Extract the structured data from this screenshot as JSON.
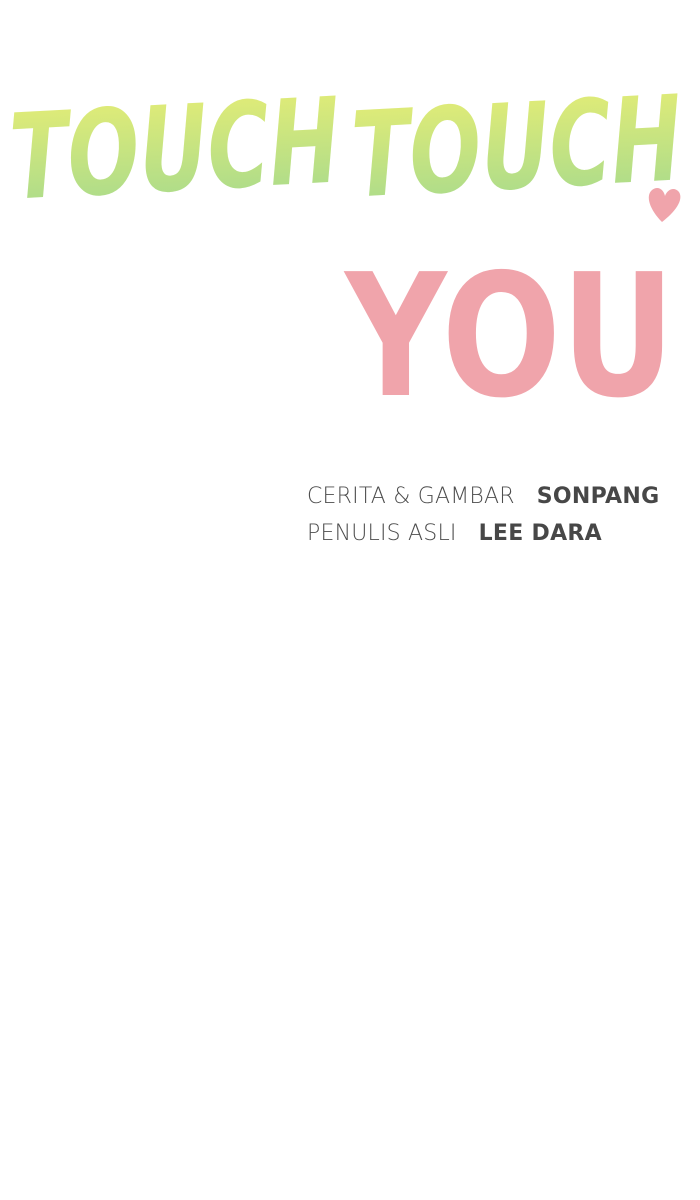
{
  "title": {
    "word1": "TOUCH",
    "word2": "TOUCH",
    "word3": "YOU",
    "colors": {
      "green_start": "#a9d98a",
      "green_end": "#e6ec72",
      "pink": "#f0a4ab"
    }
  },
  "credits": [
    {
      "role": "CERITA & GAMBAR",
      "name": "SONPANG"
    },
    {
      "role": "PENULIS ASLI",
      "name": "LEE DARA"
    }
  ]
}
